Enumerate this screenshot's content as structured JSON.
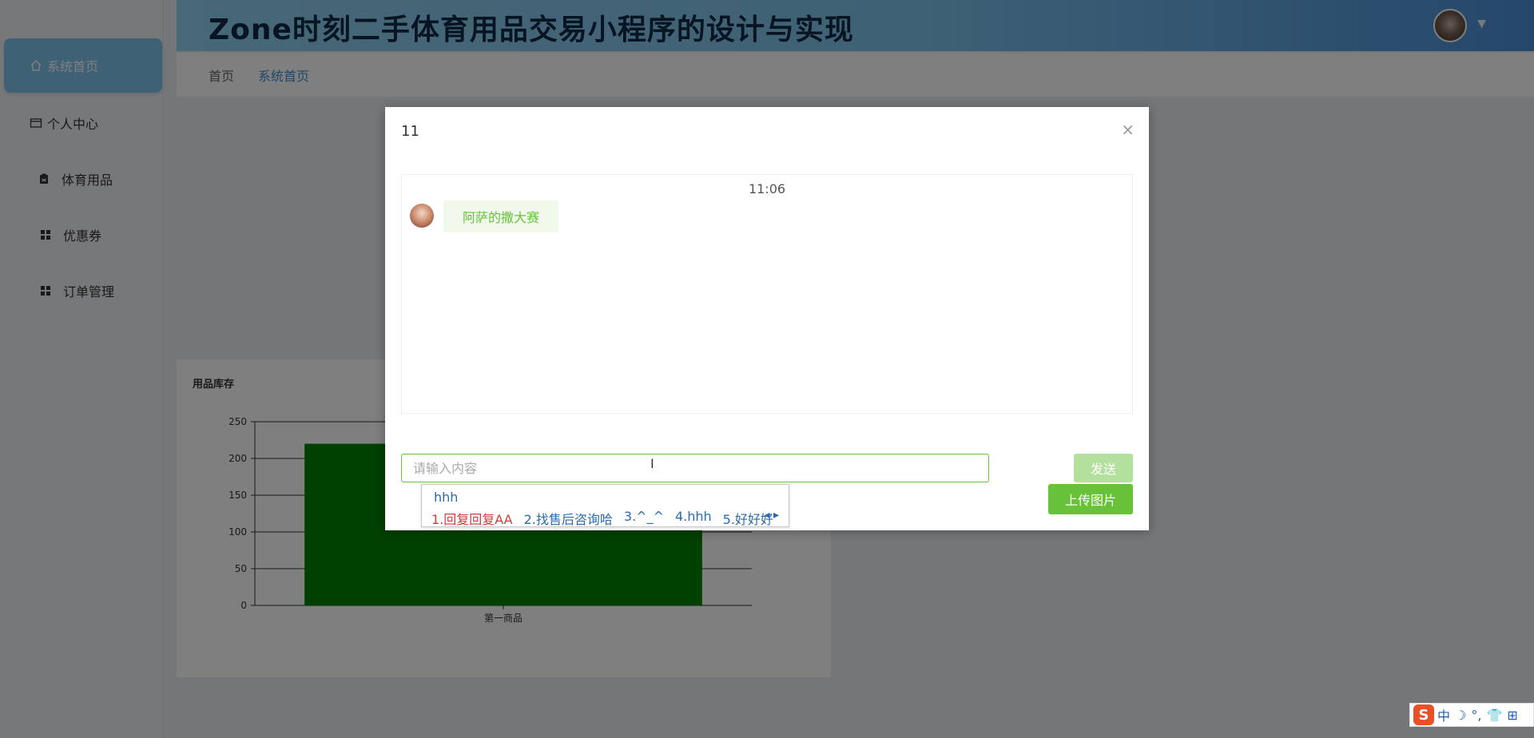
{
  "header": {
    "title": "Zone时刻二手体育用品交易小程序的设计与实现"
  },
  "sidebar": {
    "items": [
      {
        "label": "系统首页",
        "icon": "home-icon"
      },
      {
        "label": "个人中心",
        "icon": "card-icon"
      },
      {
        "label": "体育用品",
        "icon": "clipboard-icon"
      },
      {
        "label": "优惠券",
        "icon": "grid-icon"
      },
      {
        "label": "订单管理",
        "icon": "grid-icon"
      }
    ]
  },
  "breadcrumb": {
    "items": [
      "首页",
      "系统首页"
    ]
  },
  "chart_card": {
    "title": "用品库存"
  },
  "chart_data": {
    "type": "bar",
    "categories": [
      "第一商品"
    ],
    "values": [
      220
    ],
    "ylim": [
      0,
      250
    ],
    "yticks": [
      0,
      50,
      100,
      150,
      200,
      250
    ],
    "bar_color": "#008000",
    "grid": true
  },
  "dialog": {
    "title": "11",
    "close_symbol": "×",
    "chat_time": "11:06",
    "message": "阿萨的撒大赛",
    "input_placeholder": "请输入内容",
    "send_label": "发送",
    "upload_label": "上传图片"
  },
  "ime_popup": {
    "composition": "hhh",
    "candidates": [
      "1.回复回复AA",
      "2.找售后咨询哈",
      "3.^_^",
      "4.hhh",
      "5.好好好"
    ],
    "arrows": "◂ ▸"
  },
  "ime_bar": {
    "logo": "S",
    "mode": "中",
    "moon": "☽",
    "punct": "°,",
    "shirt": "👕",
    "grid": "⊞"
  },
  "colors": {
    "accent": "#7ec3ea",
    "success": "#67c23a",
    "success_light": "#b3e19d",
    "header_dark": "#0e2846"
  }
}
